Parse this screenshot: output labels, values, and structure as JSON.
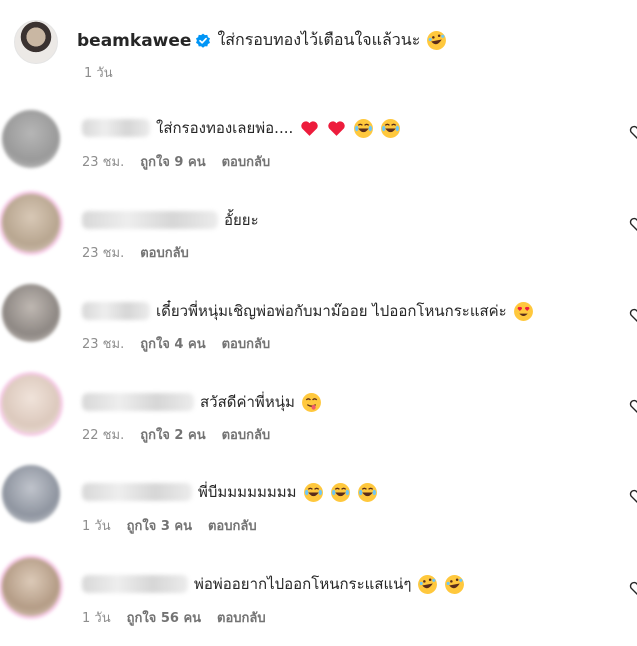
{
  "post": {
    "username": "beamkawee",
    "caption": "ใส่กรอบทองไว้เตือนใจแล้วนะ",
    "caption_emoji": "rofl-emoji",
    "time": "1 วัน"
  },
  "comments": [
    {
      "text": "ใส่กรองทองเลยพ่อ....",
      "emojis": [
        "red-heart-emoji",
        "red-heart-emoji",
        "joy-emoji",
        "joy-emoji"
      ],
      "time": "23 ชม.",
      "likes": "ถูกใจ 9 คน",
      "reply": "ตอบกลับ"
    },
    {
      "text": "อั้ยยะ",
      "emojis": [],
      "time": "23 ชม.",
      "likes": "",
      "reply": "ตอบกลับ"
    },
    {
      "text": "เดี๋ยวพี่หนุ่มเชิญพ่อพ่อกับมาม๊ออย ไปออกโหนกระแสค่ะ",
      "emojis": [
        "heart-eyes-emoji"
      ],
      "time": "23 ชม.",
      "likes": "ถูกใจ 4 คน",
      "reply": "ตอบกลับ"
    },
    {
      "text": "สวัสดีค่าพี่หนุ่ม",
      "emojis": [
        "yum-emoji"
      ],
      "time": "22 ชม.",
      "likes": "ถูกใจ 2 คน",
      "reply": "ตอบกลับ"
    },
    {
      "text": "พี่บีมมมมมมมม",
      "emojis": [
        "joy-emoji",
        "joy-emoji",
        "joy-emoji"
      ],
      "time": "1 วัน",
      "likes": "ถูกใจ 3 คน",
      "reply": "ตอบกลับ"
    },
    {
      "text": "พ่อพ่ออยากไปออกโหนกระแสแน่ๆ",
      "emojis": [
        "rofl-emoji",
        "rofl-emoji"
      ],
      "time": "1 วัน",
      "likes": "ถูกใจ 56 คน",
      "reply": "ตอบกลับ"
    }
  ],
  "colors": {
    "verified": "#0095f6",
    "heart_red": "#ed1c3c",
    "meta": "#737373",
    "ring": "#f6c9e6"
  }
}
